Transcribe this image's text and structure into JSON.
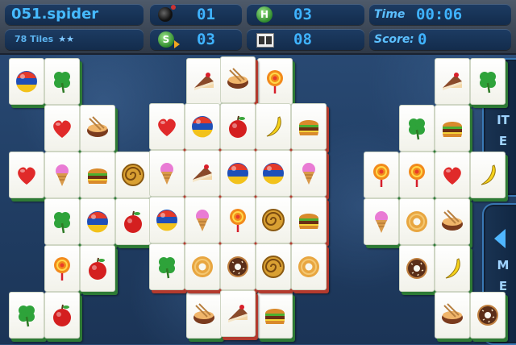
{
  "hud": {
    "level": "051.spider",
    "tiles_label": "78 Tiles",
    "stars": "★★",
    "bomb_count": "01",
    "hint_count": "03",
    "shuffle_count": "03",
    "pair_count": "08",
    "time_label": "Time",
    "time_value": "00:06",
    "score_label": "Score",
    "score_value": "0",
    "hint_letter": "H",
    "shuffle_letter": "S"
  },
  "side": {
    "item_label": "ITEM",
    "menu_label": "MENU"
  },
  "board": {
    "tiles": [
      {
        "icon": "ball",
        "layer": 1,
        "col": 0,
        "row": 0
      },
      {
        "icon": "clover",
        "layer": 1,
        "col": 1,
        "row": 0
      },
      {
        "icon": "cake",
        "layer": 1,
        "col": 5,
        "row": 0
      },
      {
        "icon": "noodles",
        "layer": 2,
        "col": 6,
        "row": 0
      },
      {
        "icon": "lollipop",
        "layer": 1,
        "col": 7,
        "row": 0
      },
      {
        "icon": "cake",
        "layer": 1,
        "col": 12,
        "row": 0
      },
      {
        "icon": "clover",
        "layer": 1,
        "col": 13,
        "row": 0
      },
      {
        "icon": "heart",
        "layer": 1,
        "col": 1,
        "row": 1
      },
      {
        "icon": "noodles",
        "layer": 1,
        "col": 2,
        "row": 1
      },
      {
        "icon": "heart",
        "layer": 2,
        "col": 4,
        "row": 1
      },
      {
        "icon": "ball",
        "layer": 2,
        "col": 5,
        "row": 1
      },
      {
        "icon": "apple",
        "layer": 2,
        "col": 6,
        "row": 1
      },
      {
        "icon": "banana",
        "layer": 2,
        "col": 7,
        "row": 1
      },
      {
        "icon": "burger",
        "layer": 2,
        "col": 8,
        "row": 1
      },
      {
        "icon": "clover",
        "layer": 1,
        "col": 11,
        "row": 1
      },
      {
        "icon": "burger",
        "layer": 1,
        "col": 12,
        "row": 1
      },
      {
        "icon": "heart",
        "layer": 1,
        "col": 0,
        "row": 2
      },
      {
        "icon": "icecream",
        "layer": 1,
        "col": 1,
        "row": 2
      },
      {
        "icon": "burger",
        "layer": 1,
        "col": 2,
        "row": 2
      },
      {
        "icon": "roll",
        "layer": 1,
        "col": 3,
        "row": 2
      },
      {
        "icon": "icecream",
        "layer": 2,
        "col": 4,
        "row": 2
      },
      {
        "icon": "cake",
        "layer": 2,
        "col": 5,
        "row": 2
      },
      {
        "icon": "ball",
        "layer": 2,
        "col": 6,
        "row": 2
      },
      {
        "icon": "ball",
        "layer": 2,
        "col": 7,
        "row": 2
      },
      {
        "icon": "icecream",
        "layer": 2,
        "col": 8,
        "row": 2
      },
      {
        "icon": "lollipop",
        "layer": 1,
        "col": 10,
        "row": 2
      },
      {
        "icon": "lollipop",
        "layer": 1,
        "col": 11,
        "row": 2
      },
      {
        "icon": "heart",
        "layer": 1,
        "col": 12,
        "row": 2
      },
      {
        "icon": "banana",
        "layer": 1,
        "col": 13,
        "row": 2
      },
      {
        "icon": "clover",
        "layer": 1,
        "col": 1,
        "row": 3
      },
      {
        "icon": "ball",
        "layer": 1,
        "col": 2,
        "row": 3
      },
      {
        "icon": "apple",
        "layer": 1,
        "col": 3,
        "row": 3
      },
      {
        "icon": "ball",
        "layer": 2,
        "col": 4,
        "row": 3
      },
      {
        "icon": "icecream",
        "layer": 2,
        "col": 5,
        "row": 3
      },
      {
        "icon": "lollipop",
        "layer": 2,
        "col": 6,
        "row": 3
      },
      {
        "icon": "roll",
        "layer": 2,
        "col": 7,
        "row": 3
      },
      {
        "icon": "burger",
        "layer": 2,
        "col": 8,
        "row": 3
      },
      {
        "icon": "icecream",
        "layer": 1,
        "col": 10,
        "row": 3
      },
      {
        "icon": "donut",
        "layer": 1,
        "col": 11,
        "row": 3
      },
      {
        "icon": "noodles",
        "layer": 1,
        "col": 12,
        "row": 3
      },
      {
        "icon": "lollipop",
        "layer": 1,
        "col": 1,
        "row": 4
      },
      {
        "icon": "apple",
        "layer": 1,
        "col": 2,
        "row": 4
      },
      {
        "icon": "clover",
        "layer": 2,
        "col": 4,
        "row": 4
      },
      {
        "icon": "donut",
        "layer": 2,
        "col": 5,
        "row": 4
      },
      {
        "icon": "chocodonut",
        "layer": 2,
        "col": 6,
        "row": 4
      },
      {
        "icon": "roll",
        "layer": 2,
        "col": 7,
        "row": 4
      },
      {
        "icon": "donut",
        "layer": 2,
        "col": 8,
        "row": 4
      },
      {
        "icon": "chocodonut",
        "layer": 1,
        "col": 11,
        "row": 4
      },
      {
        "icon": "banana",
        "layer": 1,
        "col": 12,
        "row": 4
      },
      {
        "icon": "clover",
        "layer": 1,
        "col": 0,
        "row": 5
      },
      {
        "icon": "apple",
        "layer": 1,
        "col": 1,
        "row": 5
      },
      {
        "icon": "noodles",
        "layer": 1,
        "col": 5,
        "row": 5
      },
      {
        "icon": "cake",
        "layer": 2,
        "col": 6,
        "row": 5
      },
      {
        "icon": "burger",
        "layer": 1,
        "col": 7,
        "row": 5
      },
      {
        "icon": "noodles",
        "layer": 1,
        "col": 12,
        "row": 5
      },
      {
        "icon": "chocodonut",
        "layer": 1,
        "col": 13,
        "row": 5
      }
    ]
  },
  "colors": {
    "hud_text": "#3fb3ff",
    "tile_edge_low": "#2e7a35",
    "tile_edge_high": "#b33a2e"
  }
}
